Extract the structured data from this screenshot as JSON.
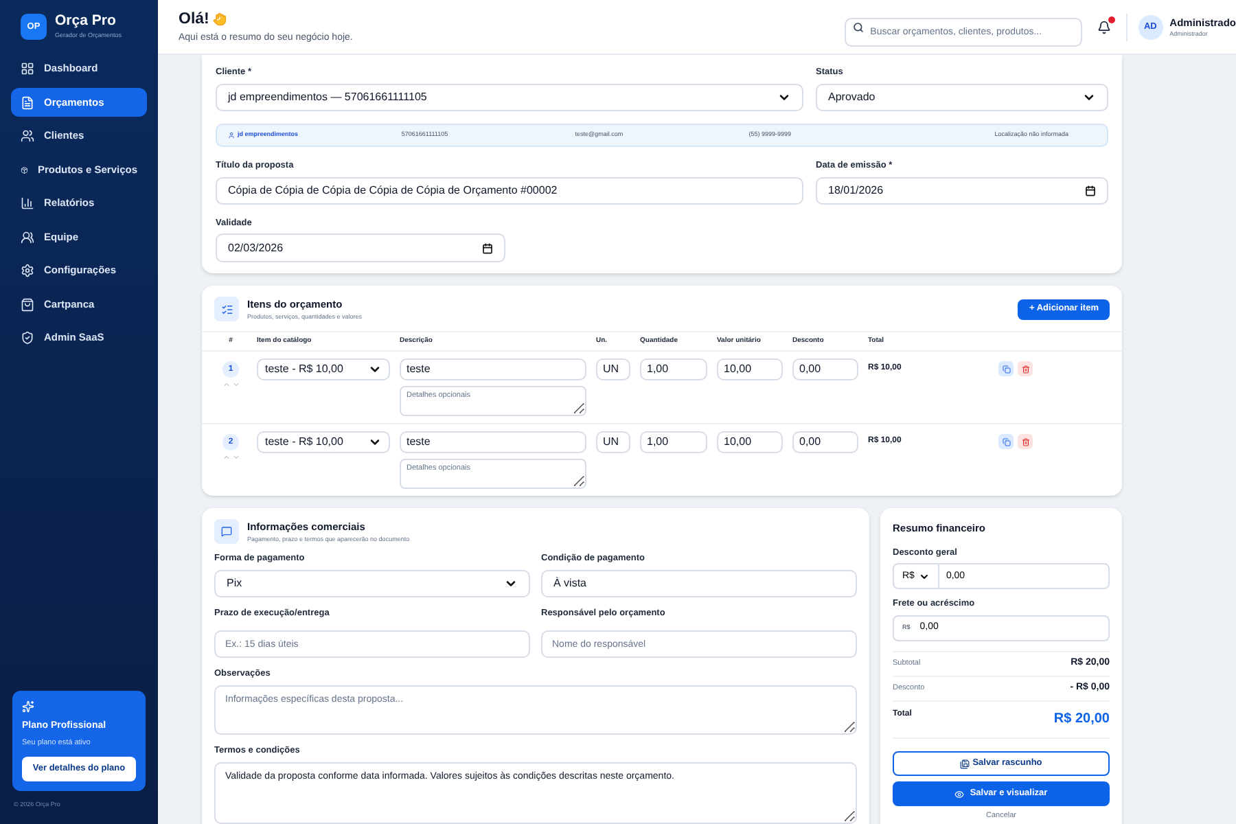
{
  "sidebar": {
    "brand": {
      "initials": "OP",
      "name": "Orça Pro",
      "tagline": "Gerador de Orçamentos"
    },
    "items": [
      {
        "label": "Dashboard",
        "selected": false
      },
      {
        "label": "Orçamentos",
        "selected": true
      },
      {
        "label": "Clientes",
        "selected": false
      },
      {
        "label": "Produtos e Serviços",
        "selected": false
      },
      {
        "label": "Relatórios",
        "selected": false
      },
      {
        "label": "Equipe",
        "selected": false
      },
      {
        "label": "Configurações",
        "selected": false
      },
      {
        "label": "Cartpanca",
        "selected": false
      },
      {
        "label": "Admin SaaS",
        "selected": false
      }
    ],
    "plan": {
      "title": "Plano Profissional",
      "status": "Seu plano está ativo",
      "button": "Ver detalhes do plano"
    },
    "footer": "© 2026 Orça Pro"
  },
  "header": {
    "greeting": "Olá!",
    "subtitle": "Aqui está o resumo do seu negócio hoje.",
    "search": {
      "placeholder": "Buscar orçamentos, clientes, produtos..."
    },
    "notifications": {
      "unread": true
    },
    "user": {
      "initials": "AD",
      "name": "Administrado",
      "role": "Administrador"
    }
  },
  "proposal": {
    "client": {
      "label": "Cliente *",
      "value": "jd empreendimentos — 57061661111105"
    },
    "status": {
      "label": "Status",
      "value": "Aprovado"
    },
    "client_info": [
      "jd empreendimentos",
      "57061661111105",
      "teste@gmail.com",
      "(55) 9999-9999",
      "Localização não informada"
    ],
    "title": {
      "label": "Título da proposta",
      "value": "Cópia de Cópia de Cópia de Cópia de Cópia de Orçamento #00002"
    },
    "issue_date": {
      "label": "Data de emissão *",
      "value": "18/01/2026"
    },
    "validity": {
      "label": "Validade",
      "value": "02/03/2026"
    }
  },
  "items": {
    "title": "Itens do orçamento",
    "subtitle": "Produtos, serviços, quantidades e valores",
    "add_button": "+ Adicionar item",
    "columns": [
      "#",
      "Item do catálogo",
      "Descrição",
      "Un.",
      "Quantidade",
      "Valor unitário",
      "Desconto",
      "Total"
    ],
    "rows": [
      {
        "number": "1",
        "catalog": "teste - R$ 10,00",
        "description": "teste",
        "details_placeholder": "Detalhes opcionais",
        "unit": "UN",
        "quantity": "1,00",
        "unit_price": "10,00",
        "discount": "0,00",
        "total": "R$ 10,00"
      },
      {
        "number": "2",
        "catalog": "teste - R$ 10,00",
        "description": "teste",
        "details_placeholder": "Detalhes opcionais",
        "unit": "UN",
        "quantity": "1,00",
        "unit_price": "10,00",
        "discount": "0,00",
        "total": "R$ 10,00"
      }
    ]
  },
  "commercial": {
    "title": "Informações comerciais",
    "subtitle": "Pagamento, prazo e termos que aparecerão no documento",
    "payment_method": {
      "label": "Forma de pagamento",
      "value": "Pix"
    },
    "payment_condition": {
      "label": "Condição de pagamento",
      "value": "À vista"
    },
    "deadline": {
      "label": "Prazo de execução/entrega",
      "placeholder": "Ex.: 15 dias úteis"
    },
    "responsible": {
      "label": "Responsável pelo orçamento",
      "placeholder": "Nome do responsável"
    },
    "notes": {
      "label": "Observações",
      "placeholder": "Informações específicas desta proposta..."
    },
    "terms": {
      "label": "Termos e condições",
      "value": "Validade da proposta conforme data informada. Valores sujeitos às condições descritas neste orçamento."
    }
  },
  "summary": {
    "title": "Resumo financeiro",
    "discount": {
      "label": "Desconto geral",
      "currency": "R$",
      "value": "0,00"
    },
    "surcharge": {
      "label": "Frete ou acréscimo",
      "prefix": "R$",
      "value": "0,00"
    },
    "lines": [
      {
        "label": "Subtotal",
        "value": "R$ 20,00"
      },
      {
        "label": "Desconto",
        "value": "- R$ 0,00"
      }
    ],
    "total": {
      "label": "Total",
      "value": "R$ 20,00"
    },
    "draft_button": "Salvar rascunho",
    "primary_button": "Salvar e visualizar",
    "cancel": "Cancelar"
  }
}
